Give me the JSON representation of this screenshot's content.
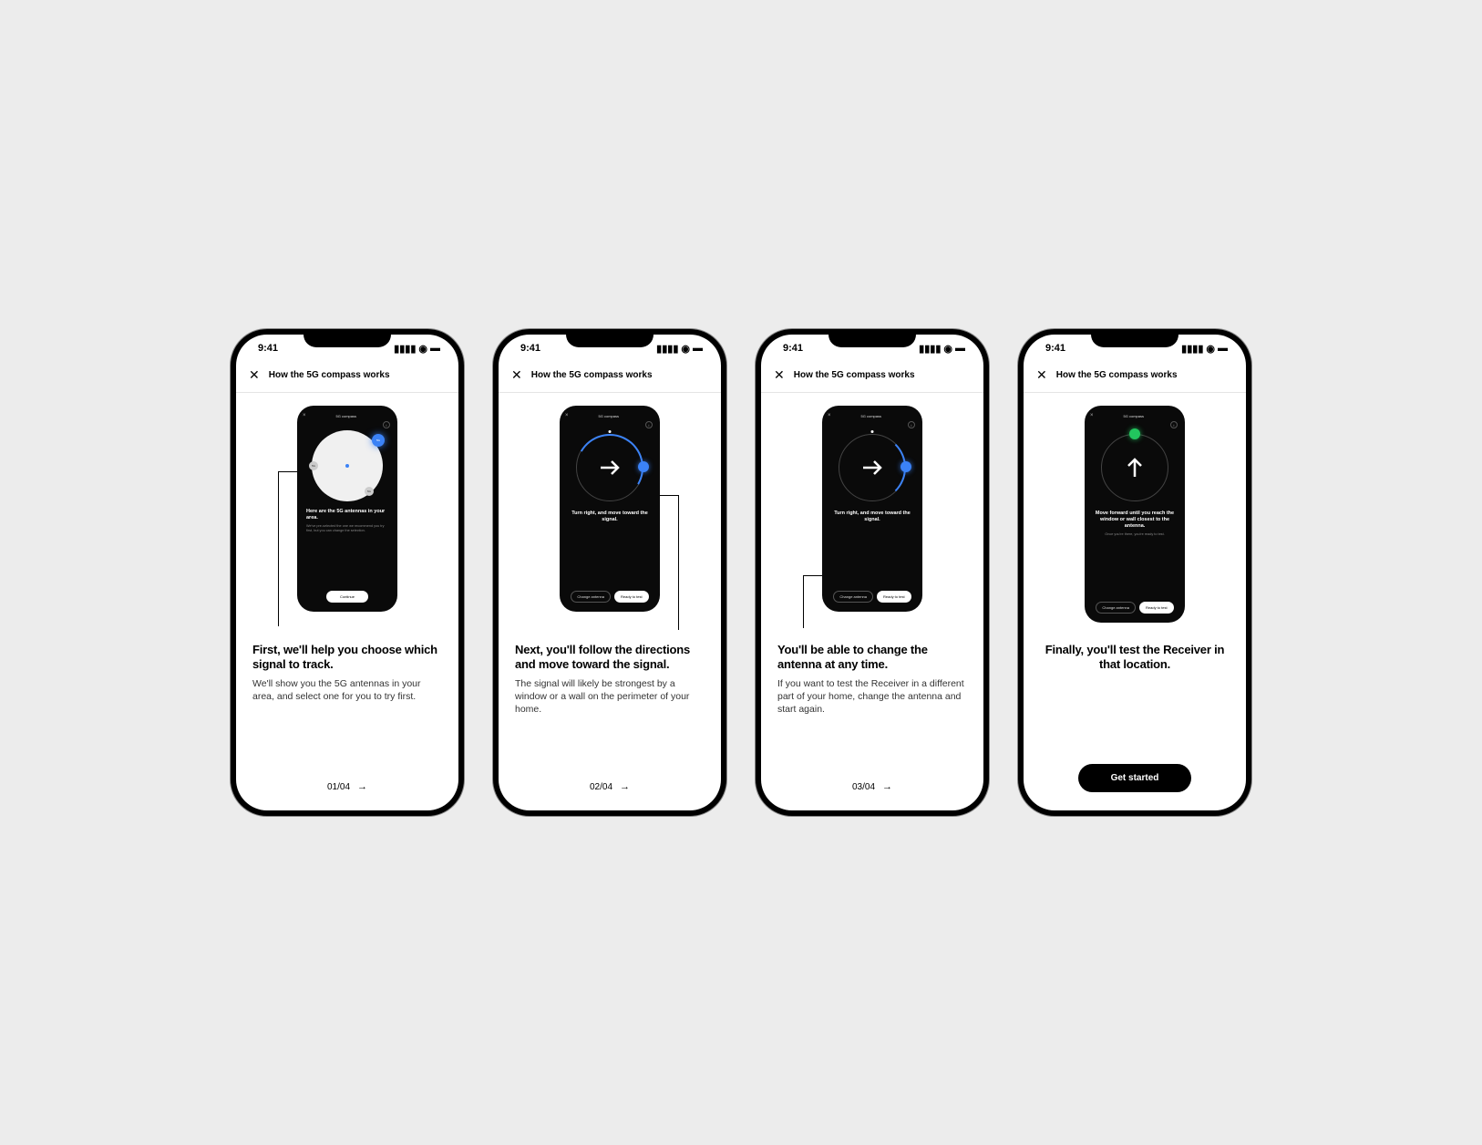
{
  "status_time": "9:41",
  "header": {
    "title": "How the 5G compass works"
  },
  "mini": {
    "title": "5G compass",
    "info_glyph": "i",
    "screen1": {
      "heading": "Here are the 5G antennas in your area.",
      "sub": "We've pre-selected the one we recommend you try first, but you can change the selection.",
      "btn": "Continue",
      "pin_label": "5G"
    },
    "screen2": {
      "heading": "Turn right, and move toward the signal.",
      "btn1": "Change antenna",
      "btn2": "Ready to test"
    },
    "screen3": {
      "heading": "Turn right, and move toward the signal.",
      "btn1": "Change antenna",
      "btn2": "Ready to test"
    },
    "screen4": {
      "heading": "Move forward until you reach the window or wall closest to the antenna.",
      "sub": "Once you're there, you're ready to test.",
      "btn1": "Change antenna",
      "btn2": "Ready to test"
    }
  },
  "steps": [
    {
      "heading": "First, we'll help you choose which signal to track.",
      "body": "We'll show you the 5G antennas in your area, and select one for you to try first.",
      "pager": "01/04"
    },
    {
      "heading": "Next, you'll follow the directions and move toward the signal.",
      "body": "The signal will likely be strongest by a window or a wall on the perimeter of your home.",
      "pager": "02/04"
    },
    {
      "heading": "You'll be able to change the antenna at any time.",
      "body": "If you want to test the Receiver in a different part of your home, change the antenna and start again.",
      "pager": "03/04"
    },
    {
      "heading": "Finally, you'll test the Receiver in that location.",
      "body": "",
      "cta": "Get started"
    }
  ]
}
